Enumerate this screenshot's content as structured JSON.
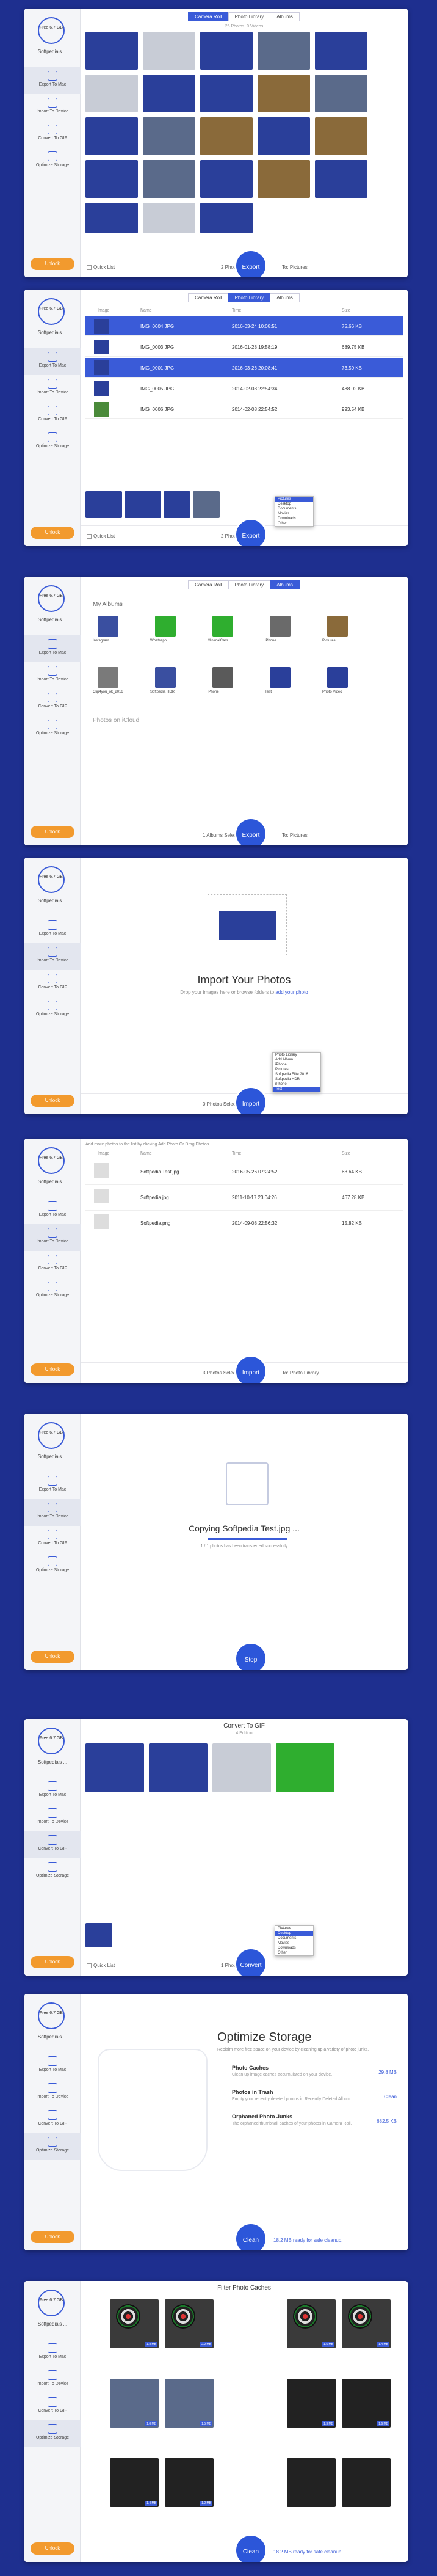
{
  "sidebar": {
    "device_size": "Free 6.7 GB",
    "device_name": "Softpedia's ...",
    "nav": [
      "Export To Mac",
      "Import To Device",
      "Convert To GIF",
      "Optimize Storage"
    ],
    "unlock_label": "Unlock"
  },
  "tabs": [
    "Camera Roll",
    "Photo Library",
    "Albums"
  ],
  "s1": {
    "subtitle": "26 Photos, 0 Videos",
    "quick_list": "Quick List",
    "selected": "2 Photos Selected",
    "dest": "To: Pictures",
    "button": "Export"
  },
  "s2": {
    "headers": [
      "Image",
      "Name",
      "Time",
      "Size"
    ],
    "rows": [
      {
        "name": "IMG_0004.JPG",
        "time": "2016-03-24 10:08:51",
        "size": "75.66 KB"
      },
      {
        "name": "IMG_0003.JPG",
        "time": "2016-01-28 19:58:19",
        "size": "689.75 KB"
      },
      {
        "name": "IMG_0001.JPG",
        "time": "2016-03-26 20:08:41",
        "size": "73.50 KB"
      },
      {
        "name": "IMG_0005.JPG",
        "time": "2014-02-08 22:54:34",
        "size": "488.02 KB"
      },
      {
        "name": "IMG_0006.JPG",
        "time": "2014-02-08 22:54:52",
        "size": "993.54 KB"
      }
    ],
    "quick_list": "Quick List",
    "selected": "2 Photos Selected",
    "button": "Export",
    "menu": [
      "Pictures",
      "Desktop",
      "Documents",
      "Movies",
      "Downloads",
      "Other"
    ]
  },
  "s3": {
    "section_albums": "My Albums",
    "albums": [
      "Instagram",
      "Whatsapp",
      "MinimalCam",
      "iPhone",
      "Pictures",
      "Clip4you_ok_2016",
      "Softpedia HDR",
      "iPhone",
      "Test",
      "Photo Video"
    ],
    "section_icloud": "Photos on iCloud",
    "selected": "1 Albums Selected",
    "dest": "To: Pictures",
    "button": "Export"
  },
  "s4": {
    "title": "Import Your Photos",
    "hint": "Drop your images here or browse folders to",
    "hint_link": "add your photo",
    "selected": "0 Photos Selected",
    "button": "Import",
    "menu": [
      "Photo Library",
      "Add Album",
      "iPhone",
      "Pictures",
      "Softpedia Elite 2016",
      "Softpedia HDR",
      "iPhone",
      "Test"
    ]
  },
  "s5": {
    "banner": "Add more photos to the list by clicking Add Photo Or Drag Photos",
    "headers": [
      "Image",
      "Name",
      "Time",
      "Size"
    ],
    "rows": [
      {
        "name": "Softpedia Test.jpg",
        "time": "2016-05-26 07:24:52",
        "size": "63.64 KB"
      },
      {
        "name": "Softpedia.jpg",
        "time": "2011-10-17 23:04:26",
        "size": "467.28 KB"
      },
      {
        "name": "Softpedia.png",
        "time": "2014-09-08 22:56:32",
        "size": "15.82 KB"
      }
    ],
    "selected": "3 Photos Selected",
    "dest": "To: Photo Library",
    "button": "Import"
  },
  "s6": {
    "title": "Copying Softpedia Test.jpg ...",
    "sub": "1 / 1 photos has been transferred successfully",
    "button": "Stop"
  },
  "s7": {
    "title": "Convert To GIF",
    "sub": "4 Edition",
    "quick_list": "Quick List",
    "selected": "1 Photo Selected",
    "button": "Convert",
    "menu": [
      "Pictures",
      "Desktop",
      "Documents",
      "Movies",
      "Downloads",
      "Other"
    ]
  },
  "s8": {
    "title": "Optimize Storage",
    "sub": "Reclaim more free space on your device by cleaning up a variety of photo junks.",
    "items": [
      {
        "t": "Photo Caches",
        "d": "Clean up image caches accumulated on your device.",
        "v": "29.8 MB"
      },
      {
        "t": "Photos in Trash",
        "d": "Empty your recently deleted photos in Recently Deleted Album.",
        "v": "Clean"
      },
      {
        "t": "Orphaned Photo Junks",
        "d": "The orphaned thumbnail caches of your photos in Camera Roll.",
        "v": "682.5 KB"
      }
    ],
    "ready": "18.2 MB ready for safe cleanup.",
    "button": "Clean"
  },
  "s9": {
    "title": "Filter Photo Caches",
    "ready": "18.2 MB ready for safe cleanup.",
    "button": "Clean",
    "tags": [
      "1.8 MB",
      "2.2 MB",
      "1.5 MB",
      "1.4 MB",
      "1.8 MB",
      "1.5 MB",
      "1.3 MB",
      "1.6 MB",
      "1.4 MB",
      "1.2 MB"
    ]
  }
}
